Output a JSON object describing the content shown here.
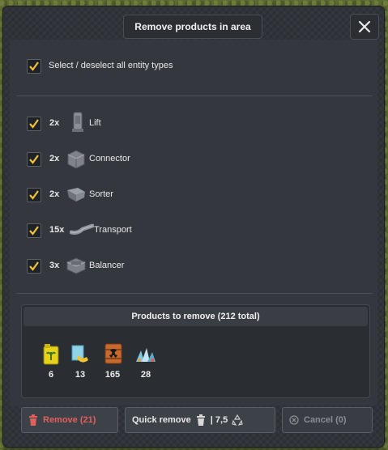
{
  "window": {
    "title": "Remove products in area"
  },
  "select_all": {
    "label": "Select / deselect all entity types",
    "checked": true
  },
  "entities": [
    {
      "count": "2x",
      "name": "Lift",
      "icon": "lift-icon"
    },
    {
      "count": "2x",
      "name": "Connector",
      "icon": "connector-icon"
    },
    {
      "count": "2x",
      "name": "Sorter",
      "icon": "sorter-icon"
    },
    {
      "count": "15x",
      "name": "Transport",
      "icon": "transport-icon"
    },
    {
      "count": "3x",
      "name": "Balancer",
      "icon": "balancer-icon"
    }
  ],
  "products": {
    "header": "Products to remove (212 total)",
    "items": [
      {
        "icon": "fertilizer-icon",
        "count": "6"
      },
      {
        "icon": "paper-icon",
        "count": "13"
      },
      {
        "icon": "radioactive-barrel-icon",
        "count": "165"
      },
      {
        "icon": "glass-shards-icon",
        "count": "28"
      }
    ]
  },
  "footer": {
    "remove_label": "Remove (21)",
    "quick_remove_label": "Quick remove",
    "quick_remove_value": "| 7,5",
    "cancel_label": "Cancel (0)"
  },
  "colors": {
    "accent_yellow": "#f4c430",
    "remove_red": "#e06060",
    "disabled": "#8a8d92"
  }
}
